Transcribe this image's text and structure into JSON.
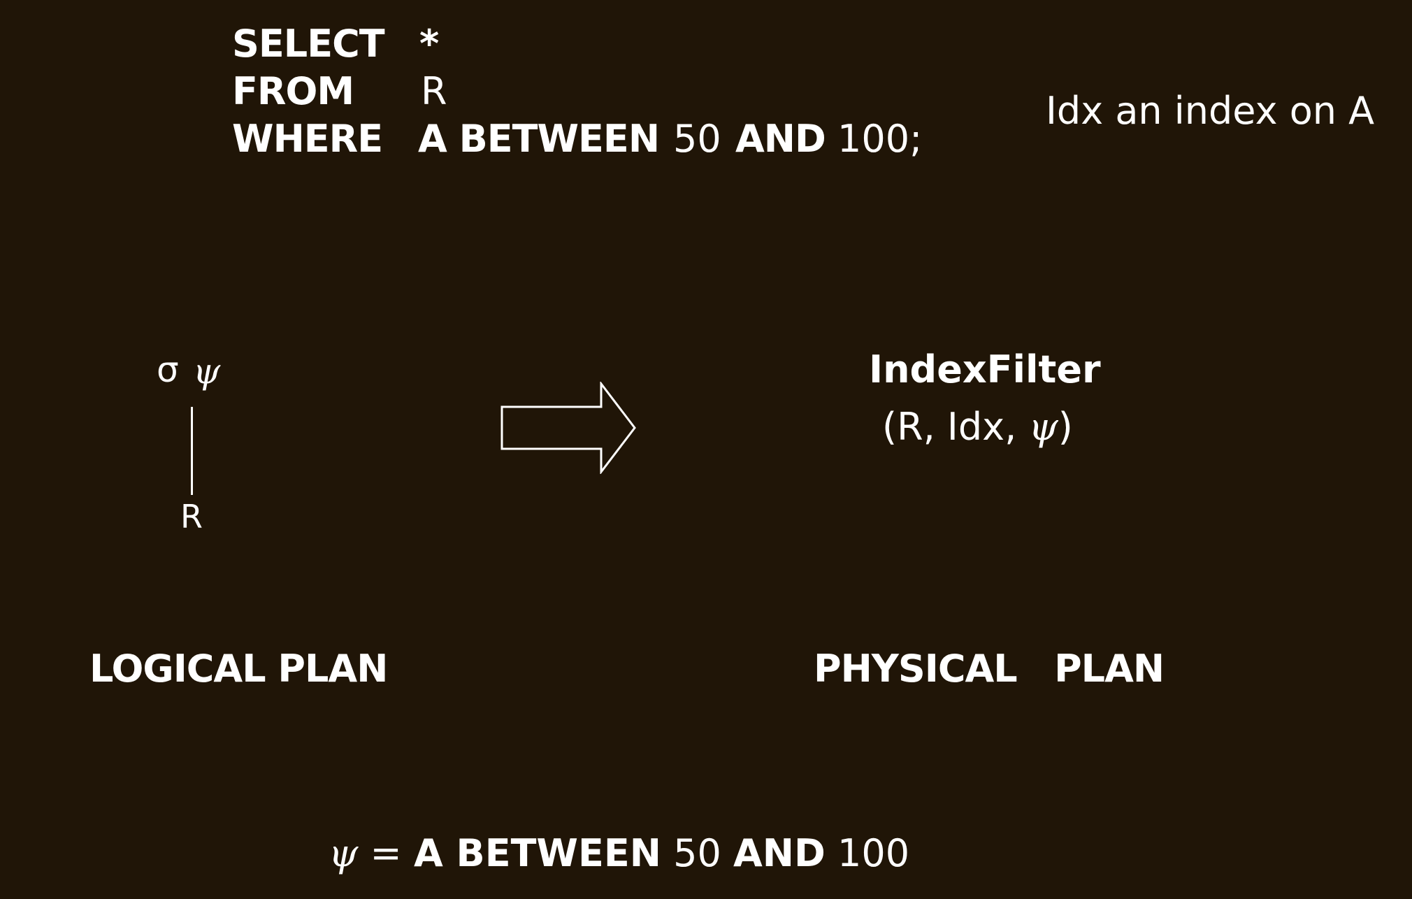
{
  "query": {
    "select_kw": "SELECT",
    "select_arg": "*",
    "from_kw": "FROM",
    "from_arg": "R",
    "where_kw": "WHERE",
    "where_arg_a": "A BETWEEN",
    "where_arg_b": "50",
    "where_arg_c": "AND",
    "where_arg_d": "100;"
  },
  "index_note": "Idx an index on A",
  "logical": {
    "sigma": "σ",
    "psi": "ψ",
    "relation": "R",
    "label": "LOGICAL PLAN"
  },
  "physical": {
    "operator": "IndexFilter",
    "args_open": "(R, Idx, ",
    "args_psi": "ψ",
    "args_close": ")",
    "label": "PHYSICAL   PLAN"
  },
  "definition": {
    "psi": "ψ",
    "eq": " = ",
    "a": "A BETWEEN",
    "b": "50",
    "c": "AND",
    "d": "100"
  }
}
